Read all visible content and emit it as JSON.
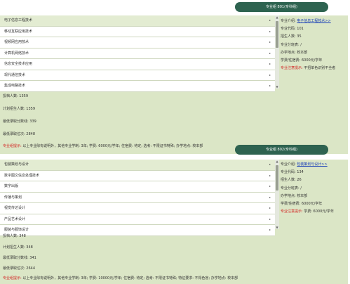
{
  "groups": [
    {
      "button": "专业组 801(专科组)",
      "majors": [
        "电子信息工程技术",
        "移动互联应用技术",
        "视频网应用技术",
        "计算机网络技术",
        "信息安全技术应用",
        "现代通信技术",
        "集成电路技术"
      ],
      "arrow": "▸",
      "detail": {
        "intro_label": "专业介绍:",
        "intro_link": "电子信息工程技术>>",
        "code": "专业代码: 101",
        "plan": "招生人数: 35",
        "direction": "专业分班表: /",
        "location": "办学地点: 校本部",
        "tuition": "学费/住宿费: 6000元/学年",
        "remind_label": "专业注意提示:",
        "remind_text": "不招单色识别不全者"
      },
      "stats": {
        "submitted": "投档人数: 1359",
        "planned": "计划招生人数: 1359",
        "min_score": "最低录取分数线: 339",
        "min_rank": "最低录取位次: 2848",
        "remind_label": "专业组提示:",
        "remind_text": "以上专业除有说明外，其他专业学制: 3年; 学费: 6000元/学年; 住宿费: 待定; 选考: 不限证书特殊; 办学地点: 校本部"
      }
    },
    {
      "button": "专业组 802(专科组)",
      "majors": [
        "包装策划与设计",
        "数字图文信息处理技术",
        "数字出版",
        "传播与策划",
        "视觉传达设计",
        "产品艺术设计",
        "服装与服饰设计"
      ],
      "arrow": "▸",
      "detail": {
        "intro_label": "专业介绍:",
        "intro_link": "包装策划与设计>>",
        "code": "专业代码: 134",
        "plan": "招生人数: 26",
        "direction": "专业分班表: /",
        "location": "办学地点: 校本部",
        "tuition": "学费/住宿费: 6000元/学年",
        "remind_label": "专业注意提示:",
        "remind_text": "学费: 6000元/学年"
      },
      "stats": {
        "submitted": "投档人数: 348",
        "planned": "计划招生人数: 348",
        "min_score": "最低录取分数线: 341",
        "min_rank": "最低录取位次: 2644",
        "remind_label": "专业组提示:",
        "remind_text": "以上专业除有说明外，其他专业学制: 3年; 学费: 10000元/学年; 住宿费: 待定; 选考: 不限证书特殊; 特征要求: 不得色盲; 办学地点: 校本部"
      }
    }
  ]
}
